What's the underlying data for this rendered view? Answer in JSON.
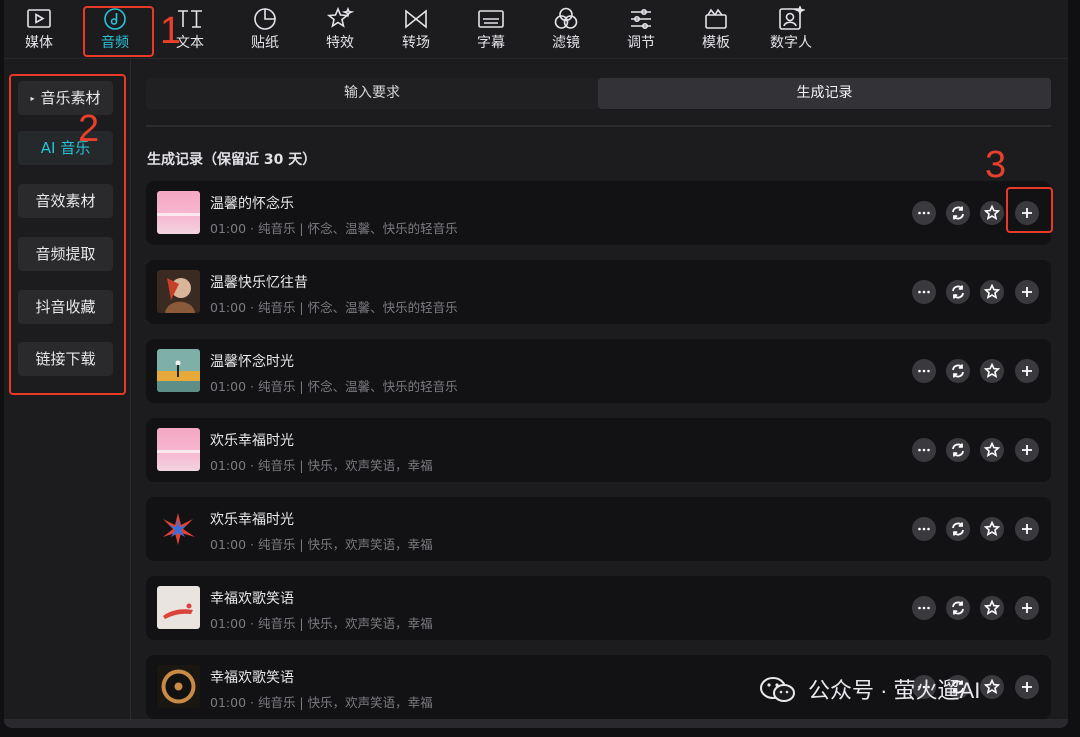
{
  "toolbar": {
    "items": [
      {
        "label": "媒体",
        "icon": "media-play-icon"
      },
      {
        "label": "音频",
        "icon": "music-note-icon",
        "active": true
      },
      {
        "label": "文本",
        "icon": "text-ti-icon"
      },
      {
        "label": "贴纸",
        "icon": "sticker-icon"
      },
      {
        "label": "特效",
        "icon": "effects-star-icon"
      },
      {
        "label": "转场",
        "icon": "transition-bowtie-icon"
      },
      {
        "label": "字幕",
        "icon": "subtitle-keyboard-icon"
      },
      {
        "label": "滤镜",
        "icon": "filter-circles-icon"
      },
      {
        "label": "调节",
        "icon": "adjust-sliders-icon"
      },
      {
        "label": "模板",
        "icon": "template-icon"
      },
      {
        "label": "数字人",
        "icon": "digital-human-icon"
      }
    ]
  },
  "sidebar": {
    "items": [
      {
        "label": "音乐素材",
        "caret": "▸"
      },
      {
        "label": "AI 音乐",
        "active": true
      },
      {
        "label": "音效素材"
      },
      {
        "label": "音频提取"
      },
      {
        "label": "抖音收藏"
      },
      {
        "label": "链接下载"
      }
    ]
  },
  "main": {
    "tabs": [
      {
        "label": "输入要求"
      },
      {
        "label": "生成记录",
        "active": true
      }
    ],
    "section_title": "生成记录（保留近 30 天）",
    "records": [
      {
        "title": "温馨的怀念乐",
        "meta": "01:00 · 纯音乐 | 怀念、温馨、快乐的轻音乐",
        "thumb": "pink-sky"
      },
      {
        "title": "温馨快乐忆往昔",
        "meta": "01:00 · 纯音乐 | 怀念、温馨、快乐的轻音乐",
        "thumb": "portrait"
      },
      {
        "title": "温馨怀念时光",
        "meta": "01:00 · 纯音乐 | 怀念、温馨、快乐的轻音乐",
        "thumb": "beach-figure"
      },
      {
        "title": "欢乐幸福时光",
        "meta": "01:00 · 纯音乐 | 快乐，欢声笑语，幸福",
        "thumb": "pink-sky"
      },
      {
        "title": "欢乐幸福时光",
        "meta": "01:00 · 纯音乐 | 快乐，欢声笑语，幸福",
        "thumb": "burst"
      },
      {
        "title": "幸福欢歌笑语",
        "meta": "01:00 · 纯音乐 | 快乐，欢声笑语，幸福",
        "thumb": "dancer"
      },
      {
        "title": "幸福欢歌笑语",
        "meta": "01:00 · 纯音乐 | 快乐，欢声笑语，幸福",
        "thumb": "vinyl"
      }
    ],
    "actions": [
      "more-icon",
      "replace-icon",
      "favorite-star-icon",
      "add-plus-icon"
    ]
  },
  "annotations": {
    "n1": "1",
    "n2": "2",
    "n3": "3",
    "color": "#e83a26"
  },
  "watermark": {
    "text": "公众号 · 萤火遛AI",
    "icon": "wechat-icon"
  },
  "colors": {
    "accent": "#27c3d6",
    "background": "#1c1c1f",
    "card": "#121214"
  }
}
